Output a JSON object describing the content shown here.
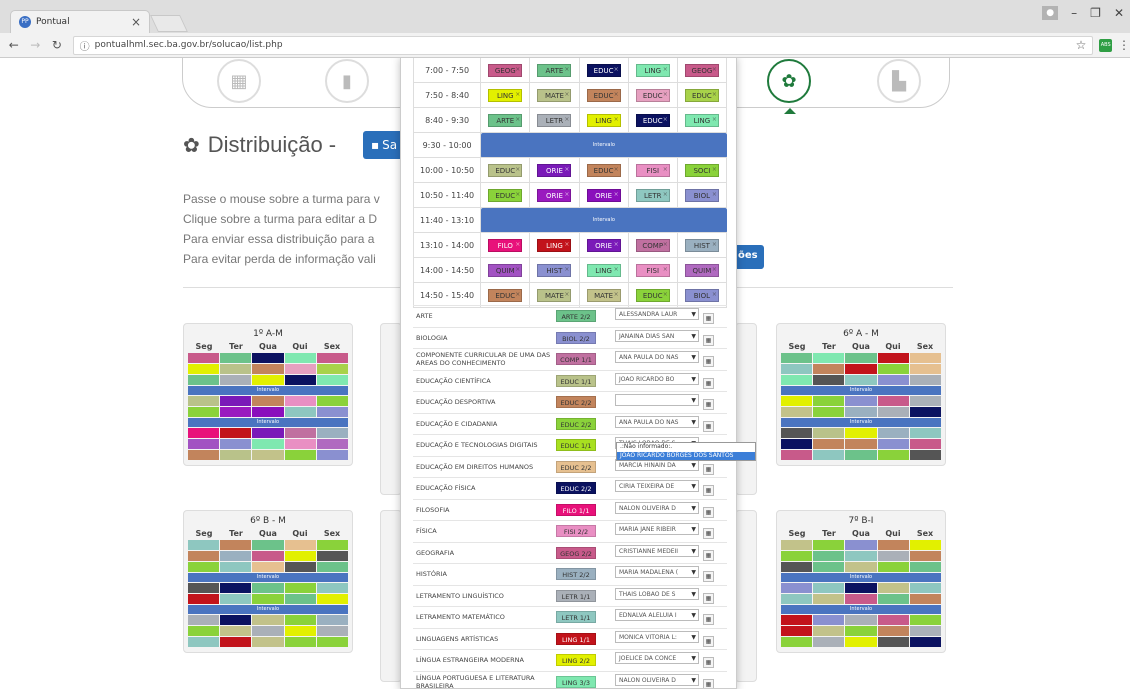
{
  "browser": {
    "tab_title": "Pontual",
    "favicon_text": "PP",
    "url": "pontualhml.sec.ba.gov.br/solucao/list.php",
    "ext_label": "ABS"
  },
  "header": {
    "title": "Distribuição -",
    "save_label": "Sa"
  },
  "instructions": [
    "Passe o mouse sobre a turma para v",
    "Clique sobre a turma para editar a D",
    "Para enviar essa distribuição para a",
    "Para evitar perda de informação vali"
  ],
  "validate_label": "ões",
  "schedule": [
    {
      "time": "7:00 - 7:50",
      "slots": [
        "GEOG",
        "ARTE",
        "EDUC",
        "LING",
        "GEOG"
      ]
    },
    {
      "time": "7:50 - 8:40",
      "slots": [
        "LING",
        "MATE",
        "EDUC",
        "EDUC",
        "EDUC"
      ]
    },
    {
      "time": "8:40 - 9:30",
      "slots": [
        "ARTE",
        "LETR",
        "LING",
        "EDUC",
        "LING"
      ]
    },
    {
      "time": "9:30 - 10:00",
      "break": "Intervalo"
    },
    {
      "time": "10:00 - 10:50",
      "slots": [
        "EDUC",
        "ORIE",
        "EDUC",
        "FISI",
        "SOCI"
      ]
    },
    {
      "time": "10:50 - 11:40",
      "slots": [
        "EDUC",
        "ORIE",
        "ORIE",
        "LETR",
        "BIOL"
      ]
    },
    {
      "time": "11:40 - 13:10",
      "break": "Intervalo"
    },
    {
      "time": "13:10 - 14:00",
      "slots": [
        "FILO",
        "LING",
        "ORIE",
        "COMP",
        "HIST"
      ]
    },
    {
      "time": "14:00 - 14:50",
      "slots": [
        "QUIM",
        "HIST",
        "LING",
        "FISI",
        "QUIM"
      ]
    },
    {
      "time": "14:50 - 15:40",
      "slots": [
        "EDUC",
        "MATE",
        "MATE",
        "EDUC",
        "BIOL"
      ]
    }
  ],
  "schedule_colors": [
    [
      "#c85a8a",
      "#6cc28a",
      "#0b1260",
      "#7fe8b0",
      "#c85a8a"
    ],
    [
      "#e2f000",
      "#b9c28a",
      "#c2845c",
      "#e6a0c0",
      "#a8d24a"
    ],
    [
      "#6cc28a",
      "#aab0b8",
      "#e2f000",
      "#0b1260",
      "#7fe8b0"
    ],
    null,
    [
      "#b9c28a",
      "#7a1ab8",
      "#c2845c",
      "#e98fc3",
      "#8ad23a"
    ],
    [
      "#8ad23a",
      "#9a1abf",
      "#8a0fbc",
      "#8ec7c0",
      "#8a90d0"
    ],
    null,
    [
      "#e8117a",
      "#c2131b",
      "#7a1ab8",
      "#c070a0",
      "#9ab0c0"
    ],
    [
      "#a252c2",
      "#8a90d0",
      "#7fe8b0",
      "#e98fc3",
      "#b06ac0"
    ],
    [
      "#c2845c",
      "#b9c28a",
      "#c2c28a",
      "#8ad23a",
      "#8a90d0"
    ]
  ],
  "subjects": [
    {
      "name": "ARTE",
      "code": "ARTE 2/2",
      "teacher": "ALESSANDRA LAUR",
      "color": "#6cc28a"
    },
    {
      "name": "BIOLOGIA",
      "code": "BIOL 2/2",
      "teacher": "JANAINA DIAS SAN",
      "color": "#8a90d0"
    },
    {
      "name": "COMPONENTE CURRICULAR DE UMA DAS AREAS DO CONHECIMENTO",
      "code": "COMP 1/1",
      "teacher": "ANA PAULA DO NAS",
      "color": "#c070a0"
    },
    {
      "name": "EDUCAÇÃO CIENTÍFICA",
      "code": "EDUC 1/1",
      "teacher": "JOAO RICARDO BO",
      "color": "#b9c28a"
    },
    {
      "name": "EDUCAÇÃO DESPORTIVA",
      "code": "EDUC 2/2",
      "teacher": "",
      "color": "#c2845c"
    },
    {
      "name": "EDUCAÇÃO E CIDADANIA",
      "code": "EDUC 2/2",
      "teacher": "ANA PAULA DO NAS",
      "color": "#8ad23a"
    },
    {
      "name": "EDUCAÇÃO E TECNOLOGIAS DIGITAIS",
      "code": "EDUC 1/1",
      "teacher": "THAIS LOBAO DE S",
      "color": "#a8e020"
    },
    {
      "name": "EDUCAÇÃO EM DIREITOS HUMANOS",
      "code": "EDUC 2/2",
      "teacher": "MARCIA HINAIN DA",
      "color": "#e6c090"
    },
    {
      "name": "EDUCAÇÃO FÍSICA",
      "code": "EDUC 2/2",
      "teacher": "CIRIA TEIXEIRA DE",
      "color": "#0b1260"
    },
    {
      "name": "FILOSOFIA",
      "code": "FILO 1/1",
      "teacher": "NALON OLIVEIRA D",
      "color": "#e8117a"
    },
    {
      "name": "FÍSICA",
      "code": "FISI 2/2",
      "teacher": "MARIA JANE RIBEIR",
      "color": "#e98fc3"
    },
    {
      "name": "GEOGRAFIA",
      "code": "GEOG 2/2",
      "teacher": "CRISTIANNE MEDEII",
      "color": "#c85a8a"
    },
    {
      "name": "HISTÓRIA",
      "code": "HIST 2/2",
      "teacher": "MARIA MADALENA (",
      "color": "#9ab0c0"
    },
    {
      "name": "LETRAMENTO LINGUÍSTICO",
      "code": "LETR 1/1",
      "teacher": "THAIS LOBAO DE S",
      "color": "#aab0b8"
    },
    {
      "name": "LETRAMENTO MATEMÁTICO",
      "code": "LETR 1/1",
      "teacher": "EDNALVA ALELUIA I",
      "color": "#8ec7c0"
    },
    {
      "name": "LINGUAGENS ARTÍSTICAS",
      "code": "LING 1/1",
      "teacher": "MONICA VITORIA L:",
      "color": "#c2131b"
    },
    {
      "name": "LÍNGUA ESTRANGEIRA MODERNA",
      "code": "LING 2/2",
      "teacher": "JOELICE DA CONCE",
      "color": "#e2f000"
    },
    {
      "name": "LÍNGUA PORTUGUESA E LITERATURA BRASILEIRA",
      "code": "LING 3/3",
      "teacher": "NALON OLIVEIRA D",
      "color": "#7fe8b0"
    }
  ],
  "dropdown": {
    "options": [
      ".:Não informado:.",
      "JOAO RICARDO BORGES DOS SANTOS"
    ]
  },
  "cards": [
    {
      "title": "1º A-M",
      "days": [
        "Seg",
        "Ter",
        "Qua",
        "Qui",
        "Sex"
      ],
      "break_label": "Intervalo",
      "rows": [
        [
          "#c85a8a",
          "#6cc28a",
          "#0b1260",
          "#7fe8b0",
          "#c85a8a"
        ],
        [
          "#e2f000",
          "#b9c28a",
          "#c2845c",
          "#e6a0c0",
          "#a8d24a"
        ],
        [
          "#6cc28a",
          "#aab0b8",
          "#e2f000",
          "#0b1260",
          "#7fe8b0"
        ],
        "B",
        [
          "#b9c28a",
          "#7a1ab8",
          "#c2845c",
          "#e98fc3",
          "#8ad23a"
        ],
        [
          "#8ad23a",
          "#9a1abf",
          "#8a0fbc",
          "#8ec7c0",
          "#8a90d0"
        ],
        "B",
        [
          "#e8117a",
          "#c2131b",
          "#7a1ab8",
          "#c070a0",
          "#9ab0c0"
        ],
        [
          "#a252c2",
          "#8a90d0",
          "#7fe8b0",
          "#e98fc3",
          "#b06ac0"
        ],
        [
          "#c2845c",
          "#b9c28a",
          "#c2c28a",
          "#8ad23a",
          "#8a90d0"
        ]
      ]
    },
    {
      "title": "6º A - M",
      "days": [
        "Seg",
        "Ter",
        "Qua",
        "Qui",
        "Sex"
      ],
      "break_label": "Intervalo",
      "rows": [
        [
          "#6cc28a",
          "#7fe8b0",
          "#6cc28a",
          "#c2131b",
          "#e6c090"
        ],
        [
          "#8ec7c0",
          "#c2845c",
          "#c2131b",
          "#8ad23a",
          "#e6c090"
        ],
        [
          "#7fe8b0",
          "#555555",
          "#8ec7c0",
          "#8a90d0",
          "#aab0b8"
        ],
        "B",
        [
          "#e2f000",
          "#8ad23a",
          "#8a90d0",
          "#c85a8a",
          "#aab0b8"
        ],
        [
          "#c2c28a",
          "#8ad23a",
          "#9ab0c0",
          "#aab0b8",
          "#0b1260"
        ],
        "B",
        [
          "#555555",
          "#b9c28a",
          "#e2f000",
          "#9ab0c0",
          "#8ec7c0"
        ],
        [
          "#0b1260",
          "#c2845c",
          "#c2845c",
          "#8a90d0",
          "#c85a8a"
        ],
        [
          "#c85a8a",
          "#8ec7c0",
          "#6cc28a",
          "#8ad23a",
          "#555555"
        ]
      ]
    },
    {
      "title": "6º B - M",
      "days": [
        "Seg",
        "Ter",
        "Qua",
        "Qui",
        "Sex"
      ],
      "break_label": "Intervalo",
      "rows": [
        [
          "#8ec7c0",
          "#c2845c",
          "#6cc28a",
          "#e6c090",
          "#8ad23a"
        ],
        [
          "#c2845c",
          "#9ab0c0",
          "#c85a8a",
          "#e2f000",
          "#555555"
        ],
        [
          "#8ad23a",
          "#8ec7c0",
          "#e6c090",
          "#555555",
          "#6cc28a"
        ],
        "B",
        [
          "#555555",
          "#0b1260",
          "#6cc28a",
          "#8ad23a",
          "#8ec7c0"
        ],
        [
          "#c2131b",
          "#8ec7c0",
          "#8ad23a",
          "#6cc28a",
          "#e2f000"
        ],
        "B",
        [
          "#aab0b8",
          "#0b1260",
          "#c2c28a",
          "#8ad23a",
          "#9ab0c0"
        ],
        [
          "#8ad23a",
          "#c2c28a",
          "#aab0b8",
          "#e2f000",
          "#aab0b8"
        ],
        [
          "#8ec7c0",
          "#c2131b",
          "#c2c28a",
          "#8ad23a",
          "#8ad23a"
        ]
      ]
    },
    {
      "title": "7º B-I",
      "days": [
        "Seg",
        "Ter",
        "Qua",
        "Qui",
        "Sex"
      ],
      "break_label": "Intervalo",
      "rows": [
        [
          "#c2c28a",
          "#8ad23a",
          "#8a90d0",
          "#c2845c",
          "#e2f000"
        ],
        [
          "#8ad23a",
          "#6cc28a",
          "#8ec7c0",
          "#aab0b8",
          "#c2845c"
        ],
        [
          "#555555",
          "#6cc28a",
          "#c2c28a",
          "#8ad23a",
          "#6cc28a"
        ],
        "B",
        [
          "#8a90d0",
          "#8ec7c0",
          "#0b1260",
          "#c2c28a",
          "#8ec7c0"
        ],
        [
          "#8ec7c0",
          "#c2c28a",
          "#c85a8a",
          "#6cc28a",
          "#c2845c"
        ],
        "B",
        [
          "#c2131b",
          "#8a90d0",
          "#aab0b8",
          "#c85a8a",
          "#8ad23a"
        ],
        [
          "#c2131b",
          "#c2c28a",
          "#8ad23a",
          "#c2845c",
          "#aab0b8"
        ],
        [
          "#8ad23a",
          "#aab0b8",
          "#e2f000",
          "#555555",
          "#0b1260"
        ]
      ]
    }
  ]
}
